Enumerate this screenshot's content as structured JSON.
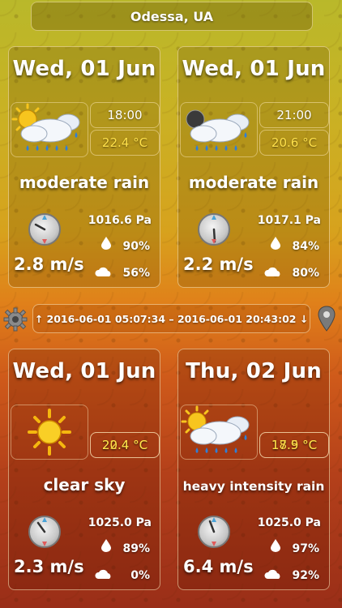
{
  "location": "Odessa, UA",
  "time_range": "↑ 2016-06-01 05:07:34 – 2016-06-01 20:43:02 ↓",
  "cards": [
    {
      "date": "Wed, 01 Jun",
      "time": "18:00",
      "temperature": "22.4 °C",
      "description": "moderate rain",
      "pressure": "1016.6 Pa",
      "humidity": "90%",
      "clouds": "56%",
      "wind": "2.8 m/s",
      "icon": "sun-cloud-rain-icon"
    },
    {
      "date": "Wed, 01 Jun",
      "time": "21:00",
      "temperature": "20.6 °C",
      "description": "moderate rain",
      "pressure": "1017.1 Pa",
      "humidity": "84%",
      "clouds": "80%",
      "wind": "2.2 m/s",
      "icon": "moon-cloud-rain-icon"
    },
    {
      "date": "Wed, 01 Jun",
      "temp_max": "22.4 °C",
      "temp_min": "20.4 °C",
      "description": "clear sky",
      "pressure": "1025.0 Pa",
      "humidity": "89%",
      "clouds": "0%",
      "wind": "2.3 m/s",
      "icon": "sun-icon"
    },
    {
      "date": "Thu, 02 Jun",
      "temp_max": "18.5 °C",
      "temp_min": "17.9 °C",
      "description": "heavy intensity rain",
      "pressure": "1025.0 Pa",
      "humidity": "97%",
      "clouds": "92%",
      "wind": "6.4 m/s",
      "icon": "sun-cloud-rain-icon"
    }
  ],
  "colors": {
    "temperature": "#ffe14a",
    "text": "#ffffff"
  }
}
